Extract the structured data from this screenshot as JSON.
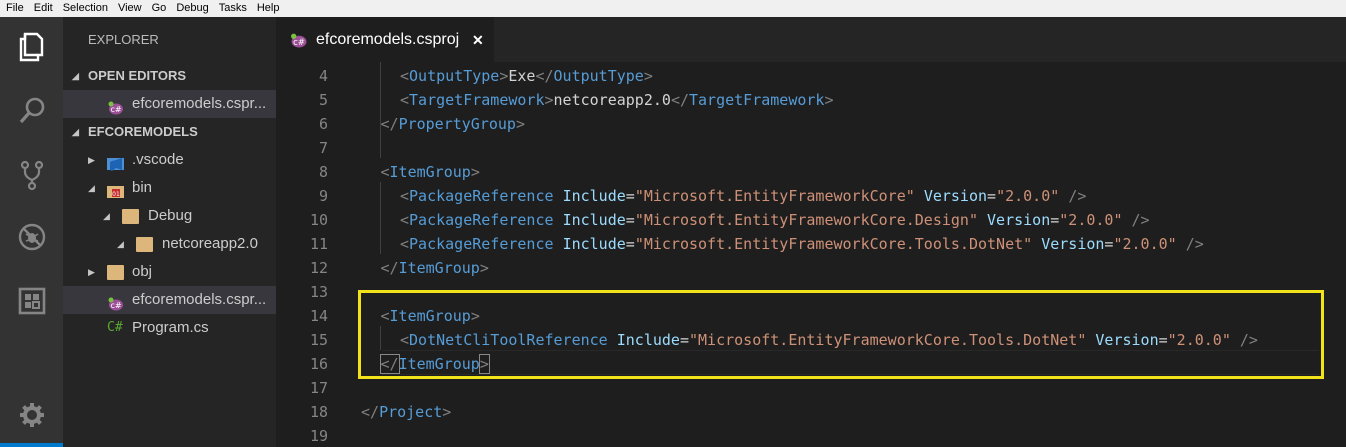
{
  "menu": [
    "File",
    "Edit",
    "Selection",
    "View",
    "Go",
    "Debug",
    "Tasks",
    "Help"
  ],
  "activity_bar": [
    {
      "name": "explorer-icon"
    },
    {
      "name": "search-icon"
    },
    {
      "name": "source-control-icon"
    },
    {
      "name": "debug-icon"
    },
    {
      "name": "extensions-icon"
    },
    {
      "name": "gear-icon"
    }
  ],
  "explorer": {
    "title": "EXPLORER",
    "open_editors_label": "OPEN EDITORS",
    "open_editors": [
      {
        "label": "efcoremodels.cspr...",
        "icon": "csproj-icon"
      }
    ],
    "project_label": "EFCOREMODELS",
    "tree": [
      {
        "label": ".vscode",
        "icon": "vscode-folder-icon",
        "indent": 0,
        "expanded": false
      },
      {
        "label": "bin",
        "icon": "bin-folder-icon",
        "indent": 0,
        "expanded": true
      },
      {
        "label": "Debug",
        "icon": "folder-icon",
        "indent": 1,
        "expanded": true
      },
      {
        "label": "netcoreapp2.0",
        "icon": "folder-icon",
        "indent": 2,
        "expanded": true
      },
      {
        "label": "obj",
        "icon": "folder-icon",
        "indent": 0,
        "expanded": false
      },
      {
        "label": "efcoremodels.cspr...",
        "icon": "csproj-icon",
        "indent": 0,
        "selected": true
      },
      {
        "label": "Program.cs",
        "icon": "csharp-icon",
        "indent": 0,
        "csharp_glyph": "C#"
      }
    ]
  },
  "tab": {
    "label": "efcoremodels.csproj",
    "close_glyph": "✕"
  },
  "editor": {
    "lines": [
      {
        "n": "4",
        "indent": 2,
        "tokens": [
          [
            "<",
            "tag-b"
          ],
          [
            "OutputType",
            "tag"
          ],
          [
            ">",
            "tag-b"
          ],
          [
            "Exe",
            "txt"
          ],
          [
            "</",
            "tag-b"
          ],
          [
            "OutputType",
            "tag"
          ],
          [
            ">",
            "tag-b"
          ]
        ]
      },
      {
        "n": "5",
        "indent": 2,
        "tokens": [
          [
            "<",
            "tag-b"
          ],
          [
            "TargetFramework",
            "tag"
          ],
          [
            ">",
            "tag-b"
          ],
          [
            "netcoreapp2.0",
            "txt"
          ],
          [
            "</",
            "tag-b"
          ],
          [
            "TargetFramework",
            "tag"
          ],
          [
            ">",
            "tag-b"
          ]
        ]
      },
      {
        "n": "6",
        "indent": 1,
        "tokens": [
          [
            "</",
            "tag-b"
          ],
          [
            "PropertyGroup",
            "tag"
          ],
          [
            ">",
            "tag-b"
          ]
        ]
      },
      {
        "n": "7",
        "indent": 0,
        "tokens": []
      },
      {
        "n": "8",
        "indent": 1,
        "tokens": [
          [
            "<",
            "tag-b"
          ],
          [
            "ItemGroup",
            "tag"
          ],
          [
            ">",
            "tag-b"
          ]
        ]
      },
      {
        "n": "9",
        "indent": 2,
        "tokens": [
          [
            "<",
            "tag-b"
          ],
          [
            "PackageReference",
            "tag"
          ],
          [
            " ",
            "txt"
          ],
          [
            "Include",
            "attr"
          ],
          [
            "=",
            "txt"
          ],
          [
            "\"Microsoft.EntityFrameworkCore\"",
            "str"
          ],
          [
            " ",
            "txt"
          ],
          [
            "Version",
            "attr"
          ],
          [
            "=",
            "txt"
          ],
          [
            "\"2.0.0\"",
            "str"
          ],
          [
            " ",
            "txt"
          ],
          [
            "/>",
            "tag-b"
          ]
        ]
      },
      {
        "n": "10",
        "indent": 2,
        "tokens": [
          [
            "<",
            "tag-b"
          ],
          [
            "PackageReference",
            "tag"
          ],
          [
            " ",
            "txt"
          ],
          [
            "Include",
            "attr"
          ],
          [
            "=",
            "txt"
          ],
          [
            "\"Microsoft.EntityFrameworkCore.Design\"",
            "str"
          ],
          [
            " ",
            "txt"
          ],
          [
            "Version",
            "attr"
          ],
          [
            "=",
            "txt"
          ],
          [
            "\"2.0.0\"",
            "str"
          ],
          [
            " ",
            "txt"
          ],
          [
            "/>",
            "tag-b"
          ]
        ]
      },
      {
        "n": "11",
        "indent": 2,
        "tokens": [
          [
            "<",
            "tag-b"
          ],
          [
            "PackageReference",
            "tag"
          ],
          [
            " ",
            "txt"
          ],
          [
            "Include",
            "attr"
          ],
          [
            "=",
            "txt"
          ],
          [
            "\"Microsoft.EntityFrameworkCore.Tools.DotNet\"",
            "str"
          ],
          [
            " ",
            "txt"
          ],
          [
            "Version",
            "attr"
          ],
          [
            "=",
            "txt"
          ],
          [
            "\"2.0.0\"",
            "str"
          ],
          [
            " ",
            "txt"
          ],
          [
            "/>",
            "tag-b"
          ]
        ]
      },
      {
        "n": "12",
        "indent": 1,
        "tokens": [
          [
            "</",
            "tag-b"
          ],
          [
            "ItemGroup",
            "tag"
          ],
          [
            ">",
            "tag-b"
          ]
        ]
      },
      {
        "n": "13",
        "indent": 0,
        "tokens": []
      },
      {
        "n": "14",
        "indent": 1,
        "tokens": [
          [
            "<",
            "tag-b"
          ],
          [
            "ItemGroup",
            "tag"
          ],
          [
            ">",
            "tag-b"
          ]
        ]
      },
      {
        "n": "15",
        "indent": 2,
        "tokens": [
          [
            "<",
            "tag-b"
          ],
          [
            "DotNetCliToolReference",
            "tag"
          ],
          [
            " ",
            "txt"
          ],
          [
            "Include",
            "attr"
          ],
          [
            "=",
            "txt"
          ],
          [
            "\"Microsoft.EntityFrameworkCore.Tools.DotNet\"",
            "str"
          ],
          [
            " ",
            "txt"
          ],
          [
            "Version",
            "attr"
          ],
          [
            "=",
            "txt"
          ],
          [
            "\"2.0.0\"",
            "str"
          ],
          [
            " ",
            "txt"
          ],
          [
            "/>",
            "tag-b"
          ]
        ]
      },
      {
        "n": "16",
        "indent": 1,
        "tokens": [
          [
            "</",
            "tag-b bracket"
          ],
          [
            "ItemGroup",
            "tag"
          ],
          [
            ">",
            "tag-b bracket"
          ]
        ]
      },
      {
        "n": "17",
        "indent": 0,
        "tokens": []
      },
      {
        "n": "18",
        "indent": 0,
        "tokens": [
          [
            "</",
            "tag-b"
          ],
          [
            "Project",
            "tag"
          ],
          [
            ">",
            "tag-b"
          ]
        ]
      },
      {
        "n": "19",
        "indent": 0,
        "tokens": []
      }
    ]
  },
  "colors": {
    "highlight_box": "#f2e21a",
    "accent": "#007acc"
  }
}
